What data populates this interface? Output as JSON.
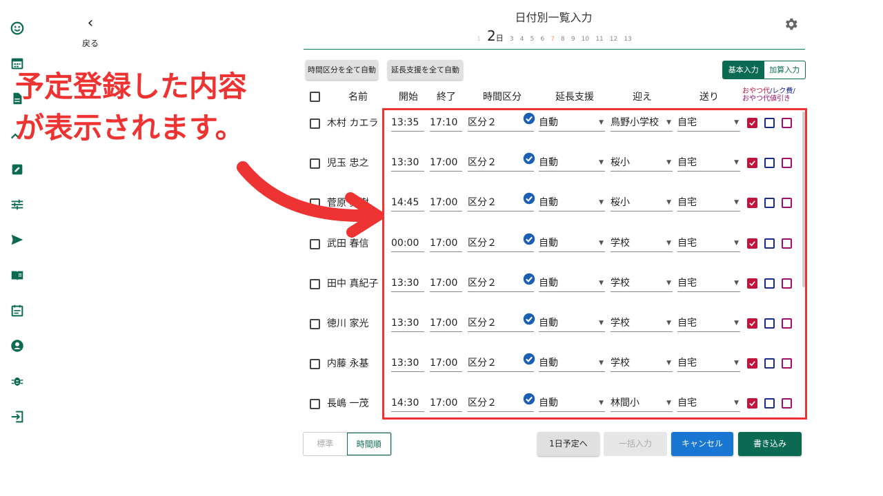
{
  "colors": {
    "accent": "#0b6b52",
    "annotation": "#ee3333",
    "cancel": "#1976d2"
  },
  "sidebar": {
    "items": [
      {
        "icon": "smile-icon"
      },
      {
        "icon": "calendar-icon"
      },
      {
        "icon": "document-icon"
      },
      {
        "icon": "chart-icon"
      },
      {
        "icon": "edit-icon"
      },
      {
        "icon": "tune-icon"
      },
      {
        "icon": "send-icon"
      },
      {
        "icon": "book-icon"
      },
      {
        "icon": "event-note-icon"
      },
      {
        "icon": "account-icon"
      },
      {
        "icon": "bug-icon"
      },
      {
        "icon": "logout-icon"
      }
    ]
  },
  "header": {
    "back_label": "戻る",
    "title": "日付別一覧入力",
    "dates": [
      "1",
      "2",
      "3",
      "4",
      "5",
      "6",
      "7",
      "8",
      "9",
      "10",
      "11",
      "12",
      "13"
    ],
    "current_date": "2",
    "current_suffix": "日"
  },
  "toolbar": {
    "auto_time_label": "時間区分を全て自動",
    "auto_ext_label": "延長支援を全て自動",
    "basic_label": "基本入力",
    "addon_label": "加算入力"
  },
  "table": {
    "headers": {
      "name": "名前",
      "start": "開始",
      "end": "終了",
      "time_class": "時間区分",
      "extension": "延長支援",
      "pickup": "迎え",
      "dropoff": "送り",
      "snack1": "おやつ代",
      "snack2": "/レク費/",
      "snack3": "おやつ代値引き"
    },
    "rows": [
      {
        "name": "木村 カエラ",
        "start": "13:35",
        "end": "17:10",
        "time_class": "区分２",
        "extension": "自動",
        "pickup": "鳥野小学校",
        "dropoff": "自宅"
      },
      {
        "name": "児玉 忠之",
        "start": "13:30",
        "end": "17:00",
        "time_class": "区分２",
        "extension": "自動",
        "pickup": "桜小",
        "dropoff": "自宅"
      },
      {
        "name": "菅原 真樹",
        "start": "14:45",
        "end": "17:00",
        "time_class": "区分２",
        "extension": "自動",
        "pickup": "桜小",
        "dropoff": "自宅"
      },
      {
        "name": "武田 春信",
        "start": "00:00",
        "end": "17:00",
        "time_class": "区分２",
        "extension": "自動",
        "pickup": "学校",
        "dropoff": "自宅"
      },
      {
        "name": "田中 真紀子",
        "start": "13:30",
        "end": "17:00",
        "time_class": "区分２",
        "extension": "自動",
        "pickup": "学校",
        "dropoff": "自宅"
      },
      {
        "name": "徳川 家光",
        "start": "13:30",
        "end": "17:00",
        "time_class": "区分２",
        "extension": "自動",
        "pickup": "学校",
        "dropoff": "自宅"
      },
      {
        "name": "内藤 永基",
        "start": "13:30",
        "end": "17:00",
        "time_class": "区分２",
        "extension": "自動",
        "pickup": "学校",
        "dropoff": "自宅"
      },
      {
        "name": "長嶋 一茂",
        "start": "14:30",
        "end": "17:00",
        "time_class": "区分２",
        "extension": "自動",
        "pickup": "林間小",
        "dropoff": "自宅"
      }
    ]
  },
  "annotation": {
    "line1": "予定登録した内容",
    "line2": "が表示されます。"
  },
  "footer": {
    "sort_standard": "標準",
    "sort_time": "時間順",
    "day_plan": "1日予定へ",
    "bulk_input": "一括入力",
    "cancel": "キャンセル",
    "write": "書き込み"
  }
}
